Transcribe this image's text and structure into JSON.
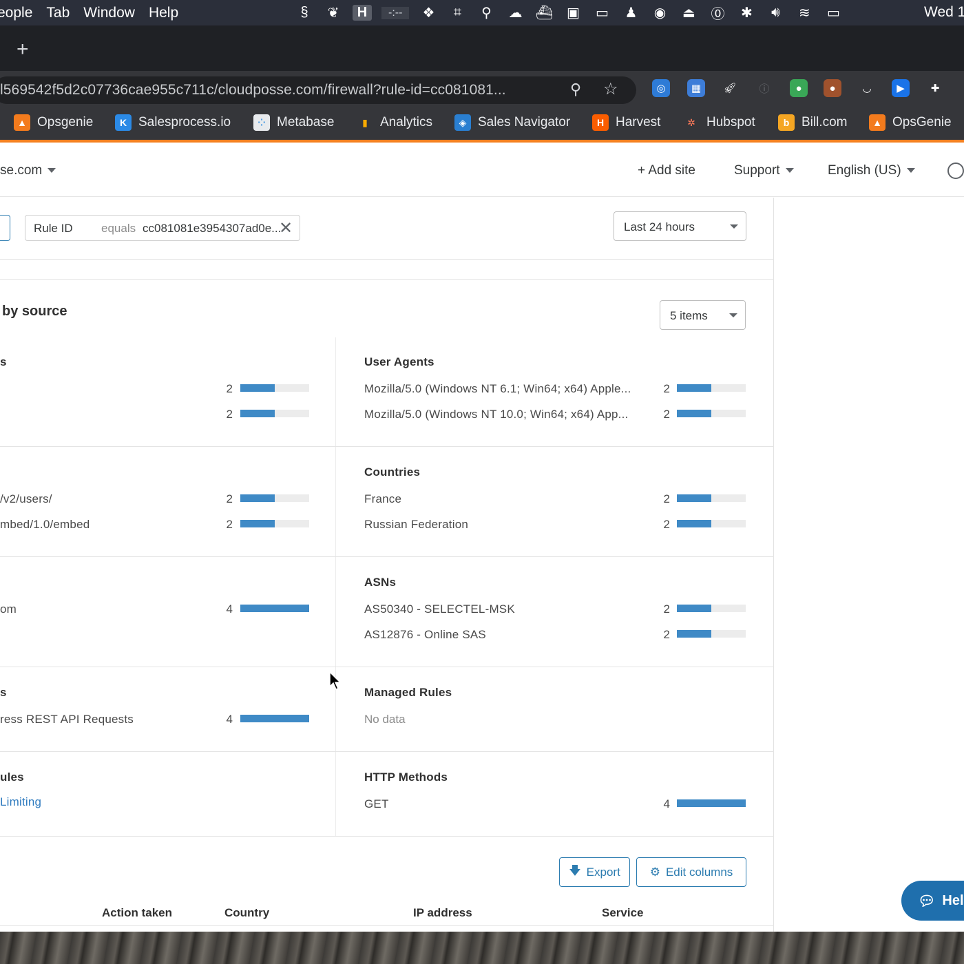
{
  "menubar": {
    "items": [
      "eople",
      "Tab",
      "Window",
      "Help"
    ],
    "tray_h": "H",
    "tray_timer": "-:--",
    "clock": "Wed 1"
  },
  "browser": {
    "new_tab": "+",
    "url": "l569542f5d2c07736cae955c711c/cloudposse.com/firewall?rule-id=cc081081...",
    "bookmarks": [
      {
        "label": "Opsgenie",
        "icon": "opsgenie-icon",
        "color": "#f37b1d"
      },
      {
        "label": "Salesprocess.io",
        "icon": "salesprocess-icon",
        "color": "#2b8ae6"
      },
      {
        "label": "Metabase",
        "icon": "metabase-icon",
        "color": "#e8eaed"
      },
      {
        "label": "Analytics",
        "icon": "analytics-icon",
        "color": "#f9ab00"
      },
      {
        "label": "Sales Navigator",
        "icon": "sales-navigator-icon",
        "color": "#2a7fd1"
      },
      {
        "label": "Harvest",
        "icon": "harvest-icon",
        "color": "#fa5d00"
      },
      {
        "label": "Hubspot",
        "icon": "hubspot-icon",
        "color": "#ff7a59"
      },
      {
        "label": "Bill.com",
        "icon": "bill-icon",
        "color": "#f5a623"
      },
      {
        "label": "OpsGenie",
        "icon": "opsgenie-icon",
        "color": "#f37b1d"
      }
    ]
  },
  "topnav": {
    "site": "se.com",
    "add_site": "+ Add site",
    "support": "Support",
    "language": "English (US)"
  },
  "filter": {
    "key": "Rule ID",
    "operator": "equals",
    "value": "cc081081e3954307ad0e...",
    "remove": "✕",
    "time_range": "Last 24 hours"
  },
  "section": {
    "title": "by source",
    "items_select": "5 items"
  },
  "panels": {
    "left_1": {
      "title": "s",
      "rows": [
        {
          "label": "",
          "count": 2,
          "fraction": 0.5
        },
        {
          "label": "",
          "count": 2,
          "fraction": 0.5
        }
      ]
    },
    "user_agents": {
      "title": "User Agents",
      "rows": [
        {
          "label": "Mozilla/5.0 (Windows NT 6.1; Win64; x64) Apple...",
          "count": 2,
          "fraction": 0.5
        },
        {
          "label": "Mozilla/5.0 (Windows NT 10.0; Win64; x64) App...",
          "count": 2,
          "fraction": 0.5
        }
      ]
    },
    "left_2": {
      "title": "",
      "rows": [
        {
          "label": "/v2/users/",
          "count": 2,
          "fraction": 0.5
        },
        {
          "label": "mbed/1.0/embed",
          "count": 2,
          "fraction": 0.5
        }
      ]
    },
    "countries": {
      "title": "Countries",
      "rows": [
        {
          "label": "France",
          "count": 2,
          "fraction": 0.5
        },
        {
          "label": "Russian Federation",
          "count": 2,
          "fraction": 0.5
        }
      ]
    },
    "left_3": {
      "title": "",
      "rows": [
        {
          "label": "om",
          "count": 4,
          "fraction": 1.0
        }
      ]
    },
    "asns": {
      "title": "ASNs",
      "rows": [
        {
          "label": "AS50340 - SELECTEL-MSK",
          "count": 2,
          "fraction": 0.5
        },
        {
          "label": "AS12876 - Online SAS",
          "count": 2,
          "fraction": 0.5
        }
      ]
    },
    "left_4": {
      "title": "s",
      "rows": [
        {
          "label": "ress REST API Requests",
          "count": 4,
          "fraction": 1.0
        }
      ]
    },
    "managed_rules": {
      "title": "Managed Rules",
      "no_data": "No data"
    },
    "left_5": {
      "title": "ules",
      "link": "Limiting"
    },
    "http_methods": {
      "title": "HTTP Methods",
      "rows": [
        {
          "label": "GET",
          "count": 4,
          "fraction": 1.0
        }
      ]
    }
  },
  "table": {
    "export": "Export",
    "edit_columns": "Edit columns",
    "columns": [
      "Action taken",
      "Country",
      "IP address",
      "Service"
    ]
  },
  "help": {
    "label": "Hel"
  },
  "colors": {
    "accent": "#f48120",
    "bar": "#3f8ac6",
    "link": "#2c7cb0"
  }
}
